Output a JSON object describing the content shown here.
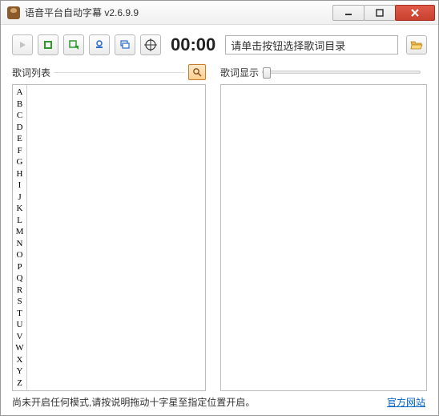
{
  "window": {
    "title": "语音平台自动字幕 v2.6.9.9"
  },
  "toolbar": {
    "time": "00:00",
    "dir_placeholder": "请单击按钮选择歌词目录"
  },
  "panels": {
    "left": {
      "label": "歌词列表"
    },
    "right": {
      "label": "歌词显示"
    }
  },
  "alphabet": [
    "A",
    "B",
    "C",
    "D",
    "E",
    "F",
    "G",
    "H",
    "I",
    "J",
    "K",
    "L",
    "M",
    "N",
    "O",
    "P",
    "Q",
    "R",
    "S",
    "T",
    "U",
    "V",
    "W",
    "X",
    "Y",
    "Z"
  ],
  "status": {
    "text": "尚未开启任何模式,请按说明拖动十字星至指定位置开启。",
    "link": "官方网站"
  }
}
